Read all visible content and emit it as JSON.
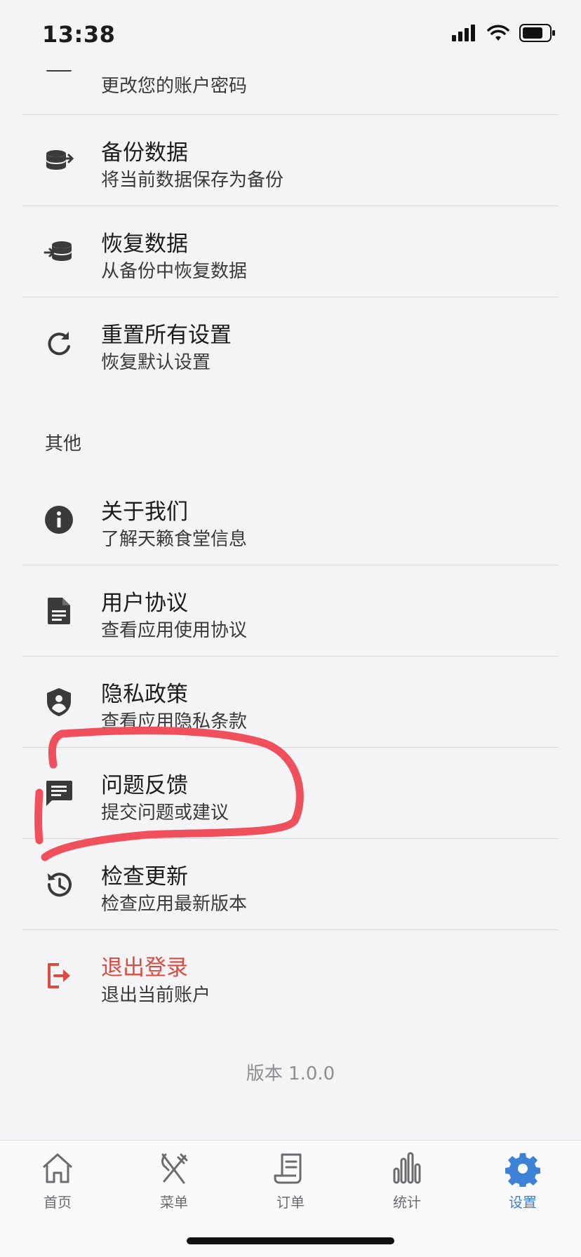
{
  "status_bar": {
    "time": "13:38"
  },
  "partial_row": {
    "subtitle": "更改您的账户密码"
  },
  "data_section": [
    {
      "title": "备份数据",
      "subtitle": "将当前数据保存为备份",
      "icon": "database-upload-icon"
    },
    {
      "title": "恢复数据",
      "subtitle": "从备份中恢复数据",
      "icon": "database-restore-icon"
    },
    {
      "title": "重置所有设置",
      "subtitle": "恢复默认设置",
      "icon": "refresh-icon"
    }
  ],
  "other_section": {
    "label": "其他",
    "items": [
      {
        "title": "关于我们",
        "subtitle": "了解天籁食堂信息",
        "icon": "info-icon"
      },
      {
        "title": "用户协议",
        "subtitle": "查看应用使用协议",
        "icon": "document-icon"
      },
      {
        "title": "隐私政策",
        "subtitle": "查看应用隐私条款",
        "icon": "shield-user-icon"
      },
      {
        "title": "问题反馈",
        "subtitle": "提交问题或建议",
        "icon": "feedback-icon"
      },
      {
        "title": "检查更新",
        "subtitle": "检查应用最新版本",
        "icon": "history-icon"
      },
      {
        "title": "退出登录",
        "subtitle": "退出当前账户",
        "icon": "logout-icon"
      }
    ]
  },
  "version": "版本 1.0.0",
  "tab_bar": {
    "active": "设置",
    "tabs": [
      {
        "label": "首页",
        "icon": "home-icon"
      },
      {
        "label": "菜单",
        "icon": "utensils-icon"
      },
      {
        "label": "订单",
        "icon": "receipt-icon"
      },
      {
        "label": "统计",
        "icon": "bar-chart-icon"
      },
      {
        "label": "设置",
        "icon": "gear-icon"
      }
    ]
  },
  "colors": {
    "background": "#f4f4f6",
    "danger": "#d94c3f",
    "accent": "#3d82d6",
    "annotation": "#f0505c"
  }
}
